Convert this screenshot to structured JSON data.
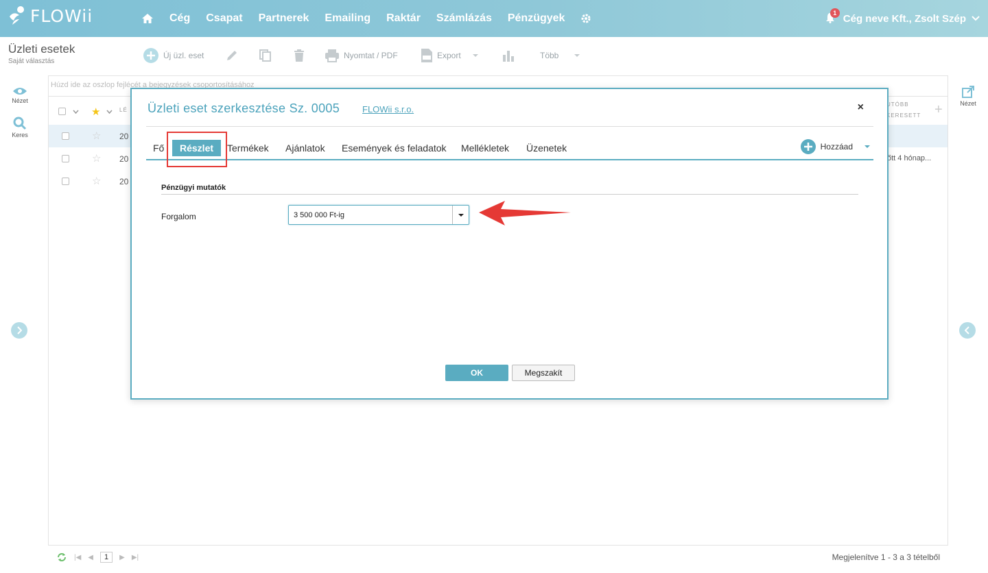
{
  "app": {
    "brand": "FLOWii"
  },
  "nav": {
    "items": [
      "Cég",
      "Csapat",
      "Partnerek",
      "Emailing",
      "Raktár",
      "Számlázás",
      "Pénzügyek"
    ],
    "notification_count": "1",
    "user_label": "Cég neve Kft., Zsolt Szép"
  },
  "page": {
    "title": "Üzleti esetek",
    "subtitle": "Saját választás"
  },
  "toolbar": {
    "new_label": "Új üzl. eset",
    "print_label": "Nyomtat / PDF",
    "export_label": "Export",
    "more_label": "Több"
  },
  "left_rail": {
    "view_label": "Nézet",
    "search_label": "Keres"
  },
  "right_rail": {
    "view_label": "Nézet"
  },
  "grid": {
    "group_hint": "Húzd ide az oszlop fejlécét a bejegyzések csoportosításához",
    "header_partial_left": "LÉ",
    "header_partial_right_1": "UTÓBB",
    "header_partial_right_2": "KERESETT",
    "rows": [
      {
        "date": "20",
        "extra": ""
      },
      {
        "date": "20",
        "extra": "őtt  4 hónap..."
      },
      {
        "date": "20",
        "extra": ""
      }
    ]
  },
  "footer": {
    "page": "1",
    "info": "Megjelenítve 1 - 3 a 3 tételből"
  },
  "dialog": {
    "title": "Üzleti eset szerkesztése Sz. 0005",
    "company_link": "FLOWii s.r.o.",
    "close": "×",
    "tabs": [
      "Fő",
      "Részlet",
      "Termékek",
      "Ajánlatok",
      "Események és feladatok",
      "Mellékletek",
      "Üzenetek"
    ],
    "active_tab": "Részlet",
    "add_label": "Hozzáad",
    "section_title": "Pénzügyi mutatók",
    "field_label": "Forgalom",
    "field_value": "3 500 000 Ft-ig",
    "ok_label": "OK",
    "cancel_label": "Megszakít"
  },
  "colors": {
    "accent": "#5aacc1",
    "highlight": "#e53935",
    "badge": "#e2555a"
  }
}
